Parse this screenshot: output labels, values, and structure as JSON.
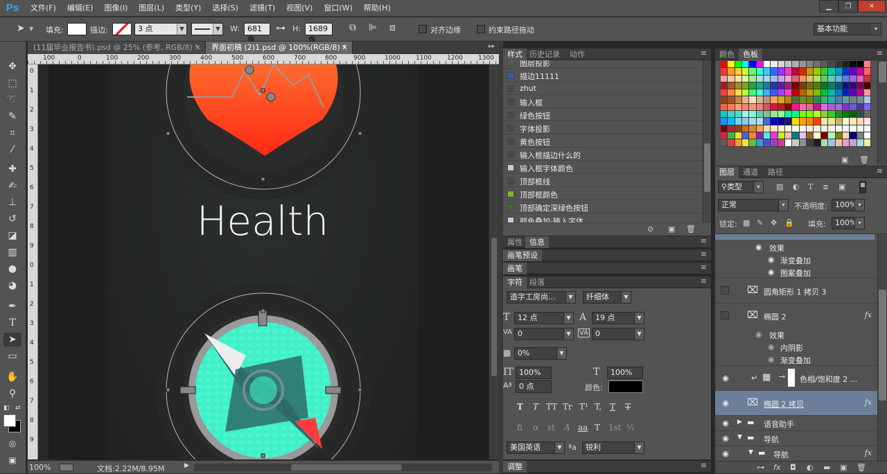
{
  "app": {
    "logo": "Ps"
  },
  "menu": [
    "文件(F)",
    "编辑(E)",
    "图像(I)",
    "图层(L)",
    "类型(Y)",
    "选择(S)",
    "滤镜(T)",
    "视图(V)",
    "窗口(W)",
    "帮助(H)"
  ],
  "options": {
    "fill_label": "填充:",
    "stroke_label": "描边:",
    "stroke_size": "3 点",
    "w_label": "W:",
    "w_value": "681 像",
    "h_label": "H:",
    "h_value": "1689 像",
    "align_edges": "对齐边缘",
    "constrain_path": "约束路径拖动",
    "workspace": "基本功能"
  },
  "doc_tabs": [
    {
      "label": "(11届毕业报告书).psd @ 25% (参考, RGB/8) *",
      "close": "×"
    },
    {
      "label": "界面初稿 (2)1.psd @ 100%(RGB/8) *",
      "close": "×"
    }
  ],
  "ruler_top_ticks": [
    "100",
    "0",
    "100",
    "200",
    "300",
    "400",
    "500",
    "600",
    "700",
    "800",
    "900",
    "1000",
    "1100",
    "1200",
    "1300"
  ],
  "ruler_left_ticks": [
    "0",
    "1",
    "2",
    "3",
    "4",
    "5",
    "6",
    "7",
    "8",
    "9",
    "0",
    "1",
    "2",
    "3",
    "4",
    "5",
    "6",
    "7",
    "8",
    "9"
  ],
  "canvas": {
    "health_text": "Health",
    "colors": {
      "background": "#242626",
      "heart_top": "#ff6a2e",
      "heart_bottom": "#ff2a14",
      "compass_fill": "#3ef0c8",
      "compass_teal": "#2f6b6b",
      "compass_red": "#ff3b3b",
      "ring": "#9a9a9a"
    }
  },
  "status": {
    "zoom": "100%",
    "doc_info": "文档:2.22M/8.95M"
  },
  "styles_panel": {
    "tabs": [
      "样式",
      "历史记录",
      "动作"
    ],
    "items": [
      {
        "name": "图层投影",
        "color": "#5a5a5a"
      },
      {
        "name": "描边11111",
        "color": "#3a5ea8"
      },
      {
        "name": "zhut",
        "color": "#4a4a4a"
      },
      {
        "name": "输入框",
        "color": "#4a4a4a"
      },
      {
        "name": "绿色按钮",
        "color": "#4a4a4a"
      },
      {
        "name": "字体投影",
        "color": "#4a4a4a"
      },
      {
        "name": "黄色按钮",
        "color": "#4a4a4a"
      },
      {
        "name": "输入框描边什么的",
        "color": "#4a4a4a"
      },
      {
        "name": "输入框字体颜色",
        "color": "#cccccc"
      },
      {
        "name": "顶部框线",
        "color": "#4a4a4a"
      },
      {
        "name": "顶部框颜色",
        "color": "#7ab82a"
      },
      {
        "name": "顶部确定深绿色按钮",
        "color": "#3f6f1e"
      },
      {
        "name": "颜色叠加-输入字体",
        "color": "#cccccc"
      }
    ]
  },
  "props_panel": {
    "tabs": [
      "属性",
      "信息"
    ]
  },
  "brush_preset_panel": {
    "title": "画笔预设"
  },
  "brush_panel": {
    "title": "画笔"
  },
  "char_panel": {
    "tabs": [
      "字符",
      "段落"
    ],
    "font_family": "造字工房尚...",
    "font_style": "纤细体",
    "font_size": "12 点",
    "leading": "19 点",
    "kerning": "0",
    "tracking": "0",
    "scale_pct": "0%",
    "vscale": "100%",
    "hscale": "100%",
    "baseline": "0 点",
    "color_label": "颜色:",
    "color_value": "#000000",
    "style_glyphs": [
      "T",
      "T",
      "TT",
      "Tr",
      "T¹",
      "T,",
      "T",
      "T"
    ],
    "ot_glyphs": [
      "fi",
      "ơ",
      "st",
      "A",
      "aa",
      "T",
      "1st",
      "½"
    ],
    "language": "美国英语",
    "aa_label": "ªa",
    "antialias": "锐利"
  },
  "adjust_panel": {
    "title": "调整"
  },
  "color_panel": {
    "tabs": [
      "颜色",
      "色板"
    ],
    "swatches": [
      "#ff0000",
      "#ffff00",
      "#00ff00",
      "#00ffff",
      "#0000ff",
      "#ff00ff",
      "#ffffff",
      "#ebebeb",
      "#d6d6d6",
      "#c2c2c2",
      "#adadad",
      "#999999",
      "#858585",
      "#707070",
      "#5c5c5c",
      "#474747",
      "#333333",
      "#1f1f1f",
      "#0a0a0a",
      "#000000",
      "#ff8080",
      "#ff3333",
      "#ff9933",
      "#ffcc33",
      "#ccff33",
      "#66ff66",
      "#33ffcc",
      "#33ccff",
      "#3366ff",
      "#9933ff",
      "#ff33cc",
      "#cc0033",
      "#cc3300",
      "#cc9900",
      "#99cc00",
      "#33cc33",
      "#00cc99",
      "#0099cc",
      "#0033cc",
      "#6600cc",
      "#cc0099",
      "#ff6666",
      "#f2a3a3",
      "#f7c8a0",
      "#fbe7a1",
      "#d9f2a3",
      "#a8e6a3",
      "#a3e6d4",
      "#a3d4f2",
      "#a3b6f2",
      "#c3a3f2",
      "#f2a3dc",
      "#e06666",
      "#e69966",
      "#e6c266",
      "#b3e066",
      "#66cc66",
      "#66ccb3",
      "#66b3e0",
      "#6680e0",
      "#9966e0",
      "#e066b3",
      "#cc3333",
      "#a61c1c",
      "#a65c1c",
      "#a68a1c",
      "#7aa61c",
      "#1ca63a",
      "#1ca68a",
      "#1c7aa6",
      "#1c3aa6",
      "#5c1ca6",
      "#a61c7a",
      "#7f0000",
      "#7f3f00",
      "#7f6a00",
      "#557f00",
      "#007f15",
      "#007f6a",
      "#00557f",
      "#00157f",
      "#3f007f",
      "#7f0055",
      "#4d0000",
      "#ff4040",
      "#ff8c40",
      "#ffd940",
      "#b3ff40",
      "#40ff73",
      "#40ffd9",
      "#40b3ff",
      "#4059ff",
      "#a640ff",
      "#ff40c6",
      "#c00000",
      "#c06000",
      "#c0a000",
      "#80c000",
      "#00c040",
      "#00c0a0",
      "#0080c0",
      "#0020c0",
      "#6000c0",
      "#c00080",
      "#ff9999",
      "#8b4513",
      "#a0522d",
      "#cd853f",
      "#deb887",
      "#f5deb3",
      "#d2b48c",
      "#bc8f8f",
      "#f4a460",
      "#daa520",
      "#b8860b",
      "#556b2f",
      "#6b8e23",
      "#808000",
      "#2e8b57",
      "#3cb371",
      "#20b2aa",
      "#4682b4",
      "#5f9ea0",
      "#708090",
      "#778899",
      "#b0c4de",
      "#ff6347",
      "#ff7f50",
      "#ffa07a",
      "#fa8072",
      "#e9967a",
      "#f08080",
      "#cd5c5c",
      "#dc143c",
      "#b22222",
      "#8b0000",
      "#ff1493",
      "#ff69b4",
      "#db7093",
      "#c71585",
      "#da70d6",
      "#ba55d3",
      "#9370db",
      "#8a2be2",
      "#6a5acd",
      "#483d8b",
      "#7b68ee",
      "#00ced1",
      "#48d1cc",
      "#40e0d0",
      "#afeeee",
      "#7fffd4",
      "#66cdaa",
      "#8fbc8f",
      "#90ee90",
      "#98fb98",
      "#00fa9a",
      "#00ff7f",
      "#7cfc00",
      "#7fff00",
      "#adff2f",
      "#9acd32",
      "#32cd32",
      "#228b22",
      "#008000",
      "#006400",
      "#2f4f4f",
      "#696969",
      "#1e90ff",
      "#00bfff",
      "#87ceeb",
      "#87cefa",
      "#add8e6",
      "#b0e0e6",
      "#4169e1",
      "#0000cd",
      "#00008b",
      "#191970",
      "#ffd700",
      "#ffa500",
      "#ff8c00",
      "#ff4500",
      "#eee8aa",
      "#f0e68c",
      "#bdb76b",
      "#fafad2",
      "#ffe4b5",
      "#ffdab9",
      "#ffe4e1",
      "#800000",
      "#a52a2a",
      "#8b4513",
      "#d2691e",
      "#cd853f",
      "#f4a460",
      "#ffdead",
      "#ffe4c4",
      "#ffebcd",
      "#fff8dc",
      "#fffaf0",
      "#fdf5e6",
      "#faebd7",
      "#faf0e6",
      "#f5f5dc",
      "#fff5ee",
      "#f0fff0",
      "#f5fffa",
      "#f0ffff",
      "#f0f8ff",
      "#f8f8ff",
      "#e6194b",
      "#3cb44b",
      "#ffe119",
      "#4363d8",
      "#f58231",
      "#911eb4",
      "#46f0f0",
      "#f032e6",
      "#bcf60c",
      "#fabebe",
      "#008080",
      "#e6beff",
      "#9a6324",
      "#fffac8",
      "#800000",
      "#aaffc3",
      "#808000",
      "#ffd8b1",
      "#000075",
      "#808080",
      "#ffffff",
      "#5c5c5c",
      "#e03c3c",
      "#f0a030",
      "#f8e040",
      "#60c040",
      "#30a0e0",
      "#5050d0",
      "#a040c0",
      "#d04090",
      "#ffffff",
      "#c8c8c8",
      "#909090",
      "#404040",
      "#202020",
      "#a0e0a0",
      "#a0c0f0",
      "#f0c0a0",
      "#e0a0c0",
      "#c0a0e0",
      "#a0e0e0",
      "#f0f0a0"
    ]
  },
  "layers_panel": {
    "tabs": [
      "图层",
      "通道",
      "路径"
    ],
    "filter": "类型",
    "blend_mode": "正常",
    "opacity_label": "不透明度:",
    "opacity_value": "100%",
    "lock_label": "锁定:",
    "fill_label": "填充:",
    "fill_value": "100%",
    "fx_label": "fx",
    "rows": [
      {
        "label": "效果",
        "kind": "effect-header"
      },
      {
        "label": "渐变叠加",
        "kind": "effect"
      },
      {
        "label": "图案叠加",
        "kind": "effect"
      },
      {
        "label": "圆角矩形 1 拷贝 3",
        "kind": "shape"
      },
      {
        "label": "椭圆 2",
        "kind": "shape"
      },
      {
        "label": "效果",
        "kind": "effect-header"
      },
      {
        "label": "内阴影",
        "kind": "effect"
      },
      {
        "label": "渐变叠加",
        "kind": "effect"
      },
      {
        "label": "色相/饱和度 2 ...",
        "kind": "adjust"
      },
      {
        "label": "椭圆 2 拷贝",
        "kind": "shape-selected"
      },
      {
        "label": "语音助手",
        "kind": "group"
      },
      {
        "label": "导航",
        "kind": "group-open"
      },
      {
        "label": "导航",
        "kind": "group-open"
      }
    ]
  }
}
